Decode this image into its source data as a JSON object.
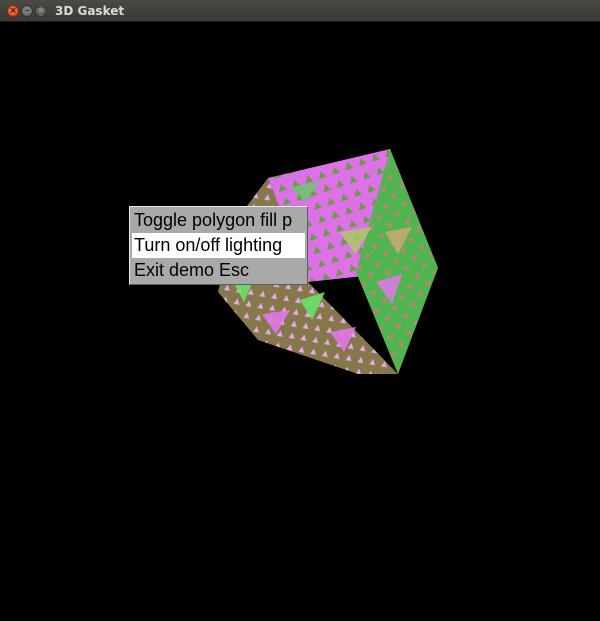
{
  "window": {
    "title": "3D Gasket",
    "close_glyph": "×",
    "min_glyph": "–",
    "max_glyph": "□"
  },
  "menu": {
    "items": [
      {
        "label": "Toggle polygon fill p",
        "highlighted": false
      },
      {
        "label": "Turn on/off lighting",
        "highlighted": true
      },
      {
        "label": "Exit demo Esc",
        "highlighted": false
      }
    ]
  },
  "scene": {
    "description_colors": {
      "background": "#000000",
      "magenta_face": "#e070e8",
      "green_face": "#50c050",
      "olive_face": "#8a7a48"
    }
  },
  "icons": [
    "close-icon",
    "minimize-icon",
    "maximize-icon"
  ]
}
